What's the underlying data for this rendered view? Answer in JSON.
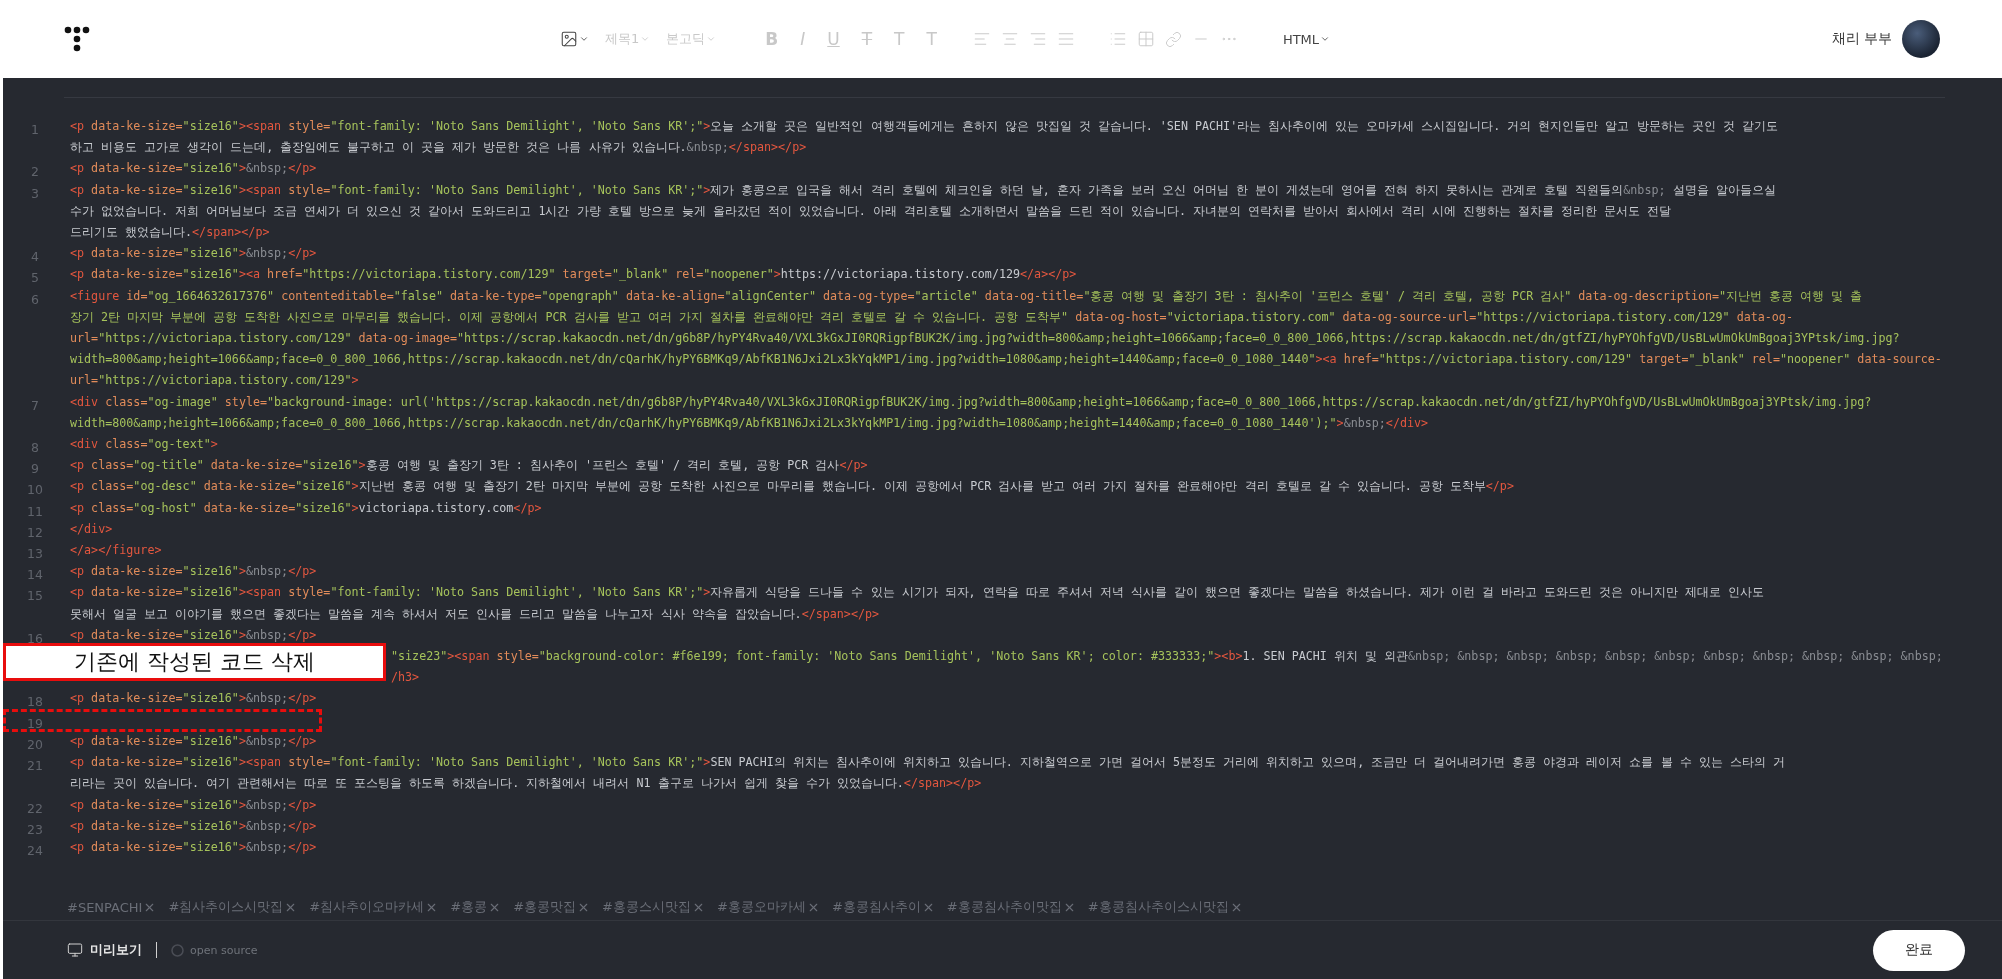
{
  "header": {
    "toolbar": {
      "disabled": true,
      "dropdowns": [
        {
          "label": "제목1"
        },
        {
          "label": "본고딕"
        }
      ],
      "format_buttons": [
        "B",
        "I",
        "U",
        "T",
        "T",
        "T"
      ],
      "mode": {
        "label": "HTML"
      }
    },
    "user": {
      "name": "채리 부부"
    }
  },
  "editor": {
    "lines": [
      {
        "number": "1",
        "rows": [
          "<p data-ke-size=\"size16\"><span style=\"font-family: 'Noto Sans Demilight', 'Noto Sans KR';\">오늘 소개할 곳은 일반적인 여행객들에게는 흔하지 않은 맛집일 것 같습니다. 'SEN PACHI'라는 침사추이에 있는 오마카세 스시집입니다. 거의 현지인들만 알고 방문하는 곳인 것 같기도",
          "하고 비용도 고가로 생각이 드는데, 출장임에도 불구하고 이 곳을 제가 방문한 것은 나름 사유가 있습니다.&nbsp;</span></p>"
        ]
      },
      {
        "number": "2",
        "rows": [
          "<p data-ke-size=\"size16\">&nbsp;</p>"
        ]
      },
      {
        "number": "3",
        "rows": [
          "<p data-ke-size=\"size16\"><span style=\"font-family: 'Noto Sans Demilight', 'Noto Sans KR';\">제가 홍콩으로 입국을 해서 격리 호텔에 체크인을 하던 날, 혼자 가족을 보러 오신 어머님 한 분이 게셨는데 영어를 전혀 하지 못하시는 관계로 호텔 직원들의&nbsp; 설명을 알아들으실",
          "수가 없었습니다. 저희 어머님보다 조금 연세가 더 있으신 것 같아서 도와드리고 1시간 가량 호텔 방으로 늦게 올라갔던 적이 있었습니다. 아래 격리호텔 소개하면서 말씀을 드린 적이 있습니다. 자녀분의 연락처를 받아서 회사에서 격리 시에 진행하는 절차를 정리한 문서도 전달",
          "드리기도 했었습니다.</span></p>"
        ]
      },
      {
        "number": "4",
        "rows": [
          "<p data-ke-size=\"size16\">&nbsp;</p>"
        ]
      },
      {
        "number": "5",
        "rows": [
          "<p data-ke-size=\"size16\"><a href=\"https://victoriapa.tistory.com/129\" target=\"_blank\" rel=\"noopener\">https://victoriapa.tistory.com/129</a></p>"
        ]
      },
      {
        "number": "6",
        "rows": [
          "<figure id=\"og_1664632617376\" contenteditable=\"false\" data-ke-type=\"opengraph\" data-ke-align=\"alignCenter\" data-og-type=\"article\" data-og-title=\"홍콩 여행 및 출장기 3탄 : 침사추이 '프린스 호텔' / 격리 호텔, 공항 PCR 검사\" data-og-description=\"지난번 홍콩 여행 및 출",
          "장기 2탄 마지막 부분에 공항 도착한 사진으로 마무리를 했습니다. 이제 공항에서 PCR 검사를 받고 여러 가지 절차를 완료해야만 격리 호텔로 갈 수 있습니다. 공항 도착부\" data-og-host=\"victoriapa.tistory.com\" data-og-source-url=\"https://victoriapa.tistory.com/129\" data-og-",
          "url=\"https://victoriapa.tistory.com/129\" data-og-image=\"https://scrap.kakaocdn.net/dn/g6b8P/hyPY4Rva40/VXL3kGxJI0RQRigpfBUK2K/img.jpg?width=800&amp;height=1066&amp;face=0_0_800_1066,https://scrap.kakaocdn.net/dn/gtfZI/hyPYOhfgVD/UsBLwUmOkUmBgoaj3YPtsk/img.jpg?",
          "width=800&amp;height=1066&amp;face=0_0_800_1066,https://scrap.kakaocdn.net/dn/cQarhK/hyPY6BMKq9/AbfKB1N6Jxi2Lx3kYqkMP1/img.jpg?width=1080&amp;height=1440&amp;face=0_0_1080_1440\"><a href=\"https://victoriapa.tistory.com/129\" target=\"_blank\" rel=\"noopener\" data-source-",
          "url=\"https://victoriapa.tistory.com/129\">"
        ]
      },
      {
        "number": "7",
        "rows": [
          "<div class=\"og-image\" style=\"background-image: url('https://scrap.kakaocdn.net/dn/g6b8P/hyPY4Rva40/VXL3kGxJI0RQRigpfBUK2K/img.jpg?width=800&amp;height=1066&amp;face=0_0_800_1066,https://scrap.kakaocdn.net/dn/gtfZI/hyPYOhfgVD/UsBLwUmOkUmBgoaj3YPtsk/img.jpg?",
          "width=800&amp;height=1066&amp;face=0_0_800_1066,https://scrap.kakaocdn.net/dn/cQarhK/hyPY6BMKq9/AbfKB1N6Jxi2Lx3kYqkMP1/img.jpg?width=1080&amp;height=1440&amp;face=0_0_1080_1440');\">&nbsp;</div>"
        ]
      },
      {
        "number": "8",
        "rows": [
          "<div class=\"og-text\">"
        ]
      },
      {
        "number": "9",
        "rows": [
          "<p class=\"og-title\" data-ke-size=\"size16\">홍콩 여행 및 출장기 3탄 : 침사추이 '프린스 호텔' / 격리 호텔, 공항 PCR 검사</p>"
        ]
      },
      {
        "number": "10",
        "rows": [
          "<p class=\"og-desc\" data-ke-size=\"size16\">지난번 홍콩 여행 및 출장기 2탄 마지막 부분에 공항 도착한 사진으로 마무리를 했습니다. 이제 공항에서 PCR 검사를 받고 여러 가지 절차를 완료해야만 격리 호텔로 갈 수 있습니다. 공항 도착부</p>"
        ]
      },
      {
        "number": "11",
        "rows": [
          "<p class=\"og-host\" data-ke-size=\"size16\">victoriapa.tistory.com</p>"
        ]
      },
      {
        "number": "12",
        "rows": [
          "</div>"
        ]
      },
      {
        "number": "13",
        "rows": [
          "</a></figure>"
        ]
      },
      {
        "number": "14",
        "rows": [
          "<p data-ke-size=\"size16\">&nbsp;</p>"
        ]
      },
      {
        "number": "15",
        "rows": [
          "<p data-ke-size=\"size16\"><span style=\"font-family: 'Noto Sans Demilight', 'Noto Sans KR';\">자유롭게 식당을 드나들 수 있는 시기가 되자, 연락을 따로 주셔서 저녁 식사를 같이 했으면 좋겠다는 말씀을 하셨습니다. 제가 이런 걸 바라고 도와드린 것은 아니지만 제대로 인사도",
          "못해서 얼굴 보고 이야기를 했으면 좋겠다는 말씀을 계속 하셔서 저도 인사를 드리고 말씀을 나누고자 식사 약속을 잡았습니다.</span></p>"
        ]
      },
      {
        "number": "16",
        "rows": [
          "<p data-ke-size=\"size16\">&nbsp;</p>"
        ]
      },
      {
        "callout": "기존에 작성된 코드 삭제",
        "rows": [
          [
            {
              "kind": "str",
              "text": "\"size23\""
            },
            {
              "kind": "tag",
              "text": "><span"
            },
            {
              "kind": "attr",
              "text": " style="
            },
            {
              "kind": "str",
              "text": "\"background-color: #f6e199; font-family: 'Noto Sans Demilight', 'Noto Sans KR'; color: #333333;\""
            },
            {
              "kind": "tag",
              "text": "><b>"
            },
            {
              "kind": "text",
              "text": "1. SEN PACHI 위치 및 외관"
            },
            {
              "kind": "ent",
              "text": "&nbsp; &nbsp; &nbsp; &nbsp; &nbsp; &nbsp; &nbsp; &nbsp; &nbsp; &nbsp; &nbsp;"
            }
          ],
          [
            {
              "kind": "tag",
              "text": "/h3>"
            }
          ]
        ]
      },
      {
        "number": "18",
        "rows": [
          "<p data-ke-size=\"size16\">&nbsp;</p>"
        ]
      },
      {
        "number": "19",
        "marked": true,
        "rows": [
          ""
        ]
      },
      {
        "number": "20",
        "rows": [
          "<p data-ke-size=\"size16\">&nbsp;</p>"
        ]
      },
      {
        "number": "21",
        "rows": [
          "<p data-ke-size=\"size16\"><span style=\"font-family: 'Noto Sans Demilight', 'Noto Sans KR';\">SEN PACHI의 위치는 침사추이에 위치하고 있습니다. 지하철역으로 가면 걸어서 5분정도 거리에 위치하고 있으며, 조금만 더 걸어내려가면 홍콩 야경과 레이저 쇼를 볼 수 있는 스타의 거",
          "리라는 곳이 있습니다. 여기 관련해서는 따로 또 포스팅을 하도록 하겠습니다. 지하철에서 내려서 N1 출구로 나가서 쉽게 찾을 수가 있었습니다.</span></p>"
        ]
      },
      {
        "number": "22",
        "rows": [
          "<p data-ke-size=\"size16\">&nbsp;</p>"
        ]
      },
      {
        "number": "23",
        "rows": [
          "<p data-ke-size=\"size16\">&nbsp;</p>"
        ]
      },
      {
        "number": "24",
        "rows": [
          "<p data-ke-size=\"size16\">&nbsp;</p>"
        ]
      }
    ]
  },
  "tags": [
    {
      "label": "#SENPACHI"
    },
    {
      "label": "#침사추이스시맛집"
    },
    {
      "label": "#침사추이오마카세"
    },
    {
      "label": "#홍콩"
    },
    {
      "label": "#홍콩맛집"
    },
    {
      "label": "#홍콩스시맛집"
    },
    {
      "label": "#홍콩오마카세"
    },
    {
      "label": "#홍콩침사추이"
    },
    {
      "label": "#홍콩침사추이맛집"
    },
    {
      "label": "#홍콩침사추이스시맛집"
    }
  ],
  "footer": {
    "preview": "미리보기",
    "open_source": "open source",
    "done": "완료"
  }
}
